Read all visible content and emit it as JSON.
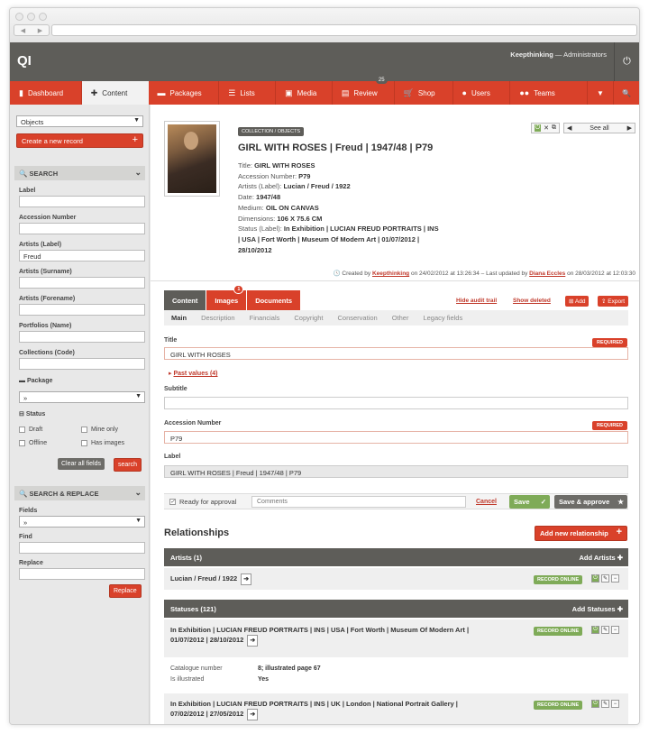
{
  "app": {
    "logo": "QI",
    "user_name": "Keepthinking",
    "user_sep": " — ",
    "user_role": "Administrators"
  },
  "nav": {
    "tabs": [
      {
        "label": "Dashboard",
        "icon": "bookmark-icon"
      },
      {
        "label": "Content",
        "icon": "plus-icon"
      },
      {
        "label": "Packages",
        "icon": "package-icon"
      },
      {
        "label": "Lists",
        "icon": "list-icon"
      },
      {
        "label": "Media",
        "icon": "media-icon"
      },
      {
        "label": "Review",
        "icon": "review-icon",
        "badge": "25"
      },
      {
        "label": "Shop",
        "icon": "cart-icon"
      },
      {
        "label": "Users",
        "icon": "user-icon"
      },
      {
        "label": "Teams",
        "icon": "team-icon"
      }
    ]
  },
  "sidebar": {
    "objects_select": "Objects",
    "create_button": "Create a new record",
    "search": {
      "title": "SEARCH",
      "fields": [
        {
          "label": "Label",
          "value": ""
        },
        {
          "label": "Accession Number",
          "value": ""
        },
        {
          "label": "Artists (Label)",
          "value": "Freud"
        },
        {
          "label": "Artists (Surname)",
          "value": ""
        },
        {
          "label": "Artists (Forename)",
          "value": ""
        },
        {
          "label": "Portfolios (Name)",
          "value": ""
        },
        {
          "label": "Collections (Code)",
          "value": ""
        }
      ],
      "package_label": "Package",
      "package_value": "»",
      "status_label": "Status",
      "checks": [
        "Draft",
        "Mine only",
        "Offline",
        "Has images"
      ],
      "clear_button": "Clear all fields",
      "search_button": "search"
    },
    "replace": {
      "title": "SEARCH & REPLACE",
      "fields_label": "Fields",
      "fields_value": "»",
      "find_label": "Find",
      "replace_label": "Replace",
      "replace_button": "Replace"
    }
  },
  "record": {
    "breadcrumb": "COLLECTION / OBJECTS",
    "title": "GIRL WITH ROSES | Freud | 1947/48 | P79",
    "meta": [
      {
        "k": "Title:",
        "v": "GIRL WITH ROSES"
      },
      {
        "k": "Accession Number:",
        "v": "P79"
      },
      {
        "k": "Artists (Label):",
        "v": "Lucian / Freud / 1922"
      },
      {
        "k": "Date:",
        "v": "1947/48"
      },
      {
        "k": "Medium:",
        "v": "OIL ON CANVAS"
      },
      {
        "k": "Dimensions:",
        "v": "106 X 75.6 CM"
      }
    ],
    "status_k": "Status (Label):",
    "status_v1": "In Exhibition | LUCIAN FREUD PORTRAITS | INS",
    "status_v2": "| USA | Fort Worth | Museum Of Modern Art | 01/07/2012 |",
    "status_v3": "28/10/2012",
    "see_all": "See all",
    "created_prefix": "Created by",
    "created_by": "Keepthinking",
    "created_on": "on 24/02/2012 at 13:26:34 – Last updated by",
    "updated_by": "Diana Eccles",
    "updated_on": "on 28/03/2012 at 12:03:30"
  },
  "content_tabs": [
    {
      "label": "Content"
    },
    {
      "label": "Images",
      "badge": "1"
    },
    {
      "label": "Documents"
    }
  ],
  "links": {
    "hide_audit": "Hide audit trail",
    "show_deleted": "Show deleted",
    "add": "Add",
    "export": "Export"
  },
  "subtabs": [
    "Main",
    "Description",
    "Financials",
    "Copyright",
    "Conservation",
    "Other",
    "Legacy fields"
  ],
  "form": {
    "title_label": "Title",
    "title_value": "GIRL WITH ROSES",
    "required": "REQUIRED",
    "past_values": "Past values (4)",
    "subtitle_label": "Subtitle",
    "subtitle_value": "",
    "accession_label": "Accession Number",
    "accession_value": "P79",
    "label_label": "Label",
    "label_value": "GIRL WITH ROSES | Freud | 1947/48 | P79",
    "ready": "Ready for approval",
    "comments_placeholder": "Comments",
    "cancel": "Cancel",
    "save": "Save",
    "save_approve": "Save & approve"
  },
  "relationships": {
    "heading": "Relationships",
    "add_new": "Add new relationship",
    "artists_title": "Artists (1)",
    "artists_add": "Add Artists",
    "artist_row": "Lucian / Freud / 1922",
    "statuses_title": "Statuses (121)",
    "statuses_add": "Add Statuses",
    "status1_l1": "In Exhibition | LUCIAN FREUD PORTRAITS | INS | USA | Fort Worth | Museum Of Modern Art |",
    "status1_l2": "01/07/2012 | 28/10/2012",
    "catalogue_k": "Catalogue number",
    "catalogue_v": "8; illustrated page 67",
    "illustrated_k": "Is illustrated",
    "illustrated_v": "Yes",
    "status2_l1": "In Exhibition | LUCIAN FREUD PORTRAITS | INS | UK | London | National Portrait Gallery |",
    "status2_l2": "07/02/2012 | 27/05/2012",
    "online": "RECORD ONLINE"
  }
}
